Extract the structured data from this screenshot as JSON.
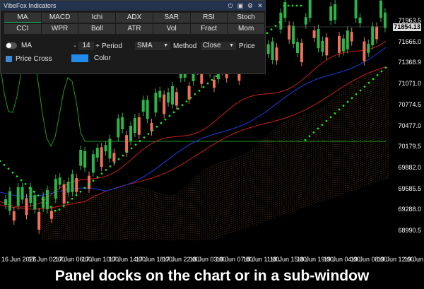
{
  "panel": {
    "title": "VibeFox Indicators",
    "titlebar_icons": [
      "power-icon",
      "save-icon",
      "gear-icon",
      "close-icon"
    ],
    "tabs_row1": [
      "MA",
      "MACD",
      "Ichi",
      "ADX",
      "SAR",
      "RSI",
      "Stoch"
    ],
    "tabs_row2": [
      "CCI",
      "WPR",
      "Boll",
      "ATR",
      "Vol",
      "Fract",
      "Mom"
    ],
    "active_tab": "MA",
    "toggle_label": "MA",
    "period_minus": "-",
    "period_value": "14",
    "period_plus": "+",
    "period_label": "Period",
    "method_value": "SMA",
    "method_label": "Method",
    "price_value": "Close",
    "price_label": "Price",
    "price_cross_label": "Price Cross",
    "color_label": "Color",
    "color_value": "#2389ea",
    "price_cross_checked": true
  },
  "price_axis": [
    "71963.5",
    "71666.0",
    "71368.9",
    "71071.0",
    "70774.5",
    "70477.0",
    "70179.5",
    "69882.0",
    "69585.5",
    "69288.0",
    "68990.5"
  ],
  "current_price": "71854.13",
  "time_axis": [
    "16 Jun 2026",
    "17 Jun 02:00",
    "17 Jun 06:00",
    "17 Jun 10:00",
    "17 Jun 14:00",
    "17 Jun 18:00",
    "17 Jun 22:00",
    "18 Jun 03:00",
    "18 Jun 07:00",
    "18 Jun 11:00",
    "18 Jun 15:00",
    "18 Jun 19:00",
    "19 Jun 04:00",
    "19 Jun 08:00",
    "19 Jun 12:00",
    "19 Jun 20:00"
  ],
  "caption": "Panel docks on the chart or in a sub-window",
  "colors": {
    "bull": "#2db34a",
    "bear": "#f07058",
    "ma_red": "#c81e1e",
    "ma_blue": "#1e3cdc",
    "ma_green": "#1f9a1f",
    "sar": "#22dd22",
    "cloud": "#a86a3c"
  }
}
